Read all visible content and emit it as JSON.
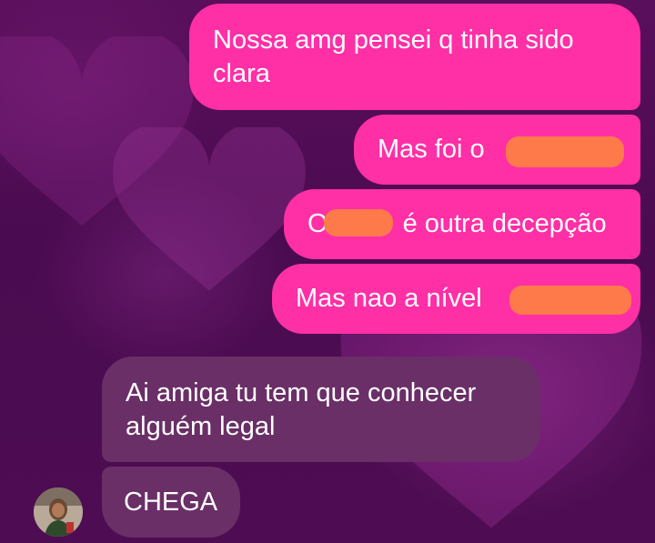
{
  "messages": {
    "m1_line1": "Nossa amg pensei q tinha sido",
    "m1_line2": "clara",
    "m2": "Mas foi o",
    "m3_prefix": "O",
    "m3_suffix": "é outra decepção",
    "m4": "Mas nao a nível",
    "m5_line1": "Ai amiga tu tem que conhecer",
    "m5_line2": "alguém legal",
    "m6": "CHEGA"
  },
  "colors": {
    "outgoing_bubble": "#ff2fa6",
    "incoming_bubble": "#6a2f67",
    "redaction": "#ff7a4a",
    "background": "#4e0d52"
  },
  "icons": {
    "avatar": "contact-avatar"
  }
}
